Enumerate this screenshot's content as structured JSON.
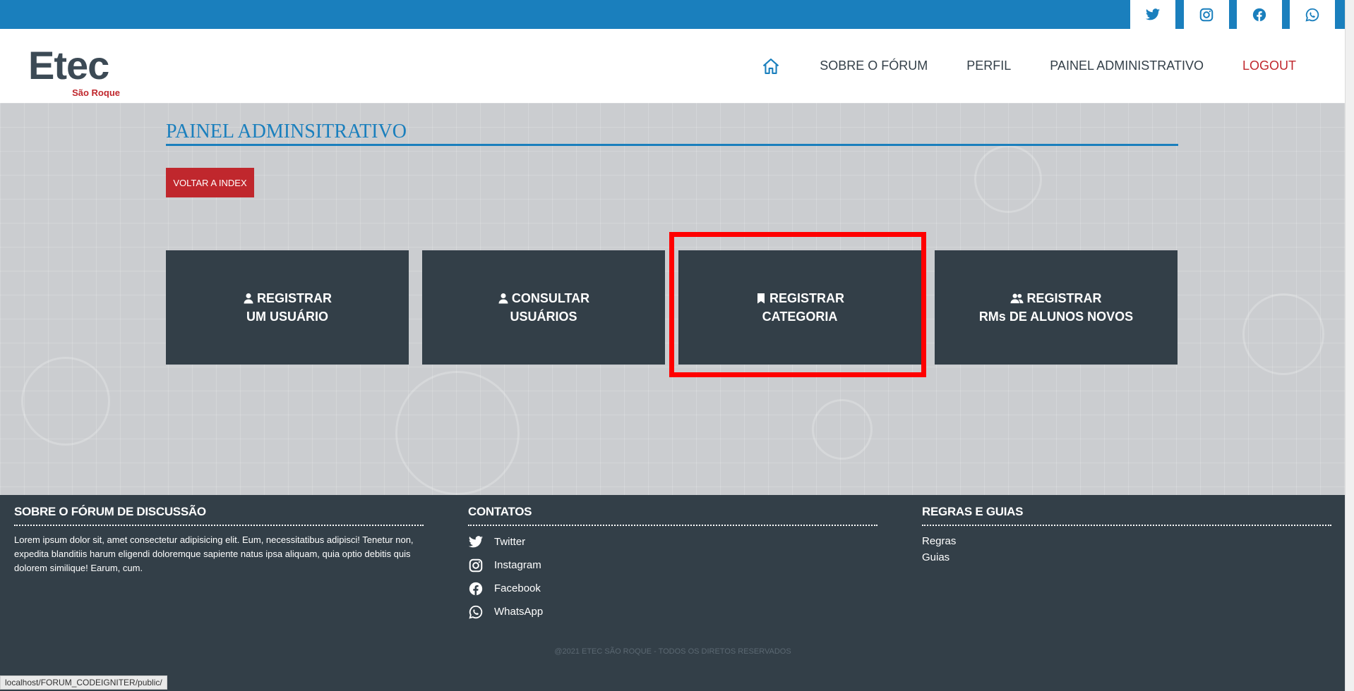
{
  "header": {
    "logo_main": "Etec",
    "logo_sub": "São Roque",
    "nav": {
      "home_icon": "home-icon",
      "about": "SOBRE O FÓRUM",
      "profile": "PERFIL",
      "admin": "PAINEL ADMINISTRATIVO",
      "logout": "LOGOUT"
    }
  },
  "social_top": [
    "twitter-icon",
    "instagram-icon",
    "facebook-icon",
    "whatsapp-icon"
  ],
  "main": {
    "title": "PAINEL ADMINSITRATIVO",
    "back_button": "VOLTAR A INDEX",
    "cards": [
      {
        "icon": "user-icon",
        "line1": "REGISTRAR",
        "line2": "UM USUÁRIO"
      },
      {
        "icon": "user-icon",
        "line1": "CONSULTAR",
        "line2": "USUÁRIOS"
      },
      {
        "icon": "bookmark-icon",
        "line1": "REGISTRAR",
        "line2": "CATEGORIA"
      },
      {
        "icon": "users-icon",
        "line1": "REGISTRAR",
        "line2": "RMs DE ALUNOS NOVOS"
      }
    ]
  },
  "footer": {
    "about_title": "SOBRE O FÓRUM DE DISCUSSÃO",
    "about_text": "Lorem ipsum dolor sit, amet consectetur adipisicing elit. Eum, necessitatibus adipisci! Tenetur non, expedita blanditiis harum eligendi doloremque sapiente natus ipsa aliquam, quia optio debitis quis dolorem similique! Earum, cum.",
    "contacts_title": "CONTATOS",
    "contacts": [
      "Twitter",
      "Instagram",
      "Facebook",
      "WhatsApp"
    ],
    "rules_title": "REGRAS E GUIAS",
    "rules": [
      "Regras",
      "Guias"
    ],
    "copyright": "@2021 ETEC SÃO ROQUE - TODOS OS DIRETOS RESERVADOS"
  },
  "status_url": "localhost/FORUM_CODEIGNITER/public/",
  "colors": {
    "accent_blue": "#1a7fbd",
    "dark": "#333f48",
    "red": "#c0272d",
    "highlight": "#ff0000"
  }
}
